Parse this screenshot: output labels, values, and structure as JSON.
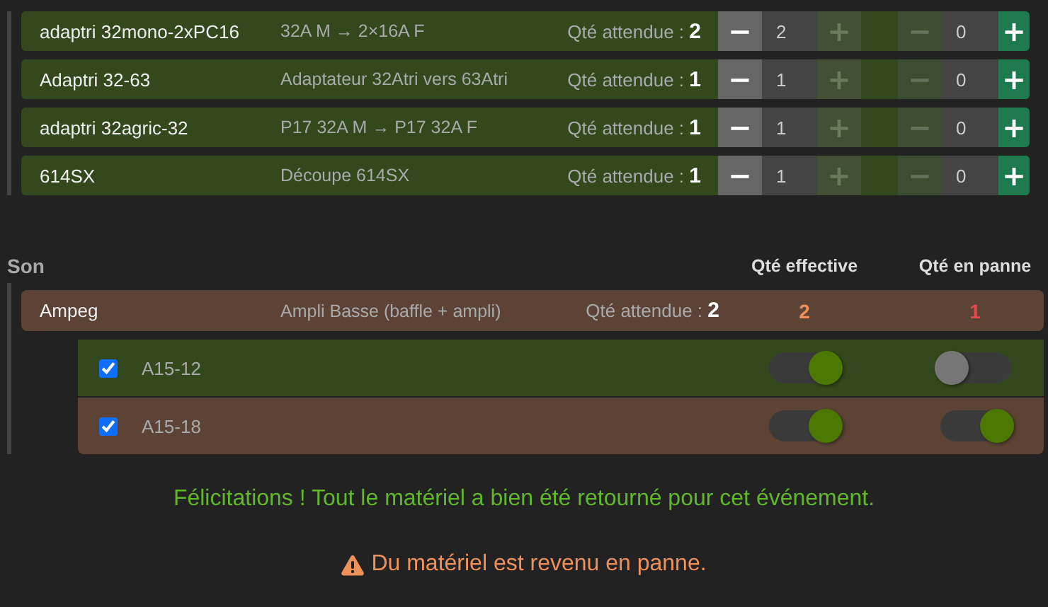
{
  "adapters": [
    {
      "name": "adaptri 32mono-2xPC16",
      "description": "32A M → 2×16A F",
      "expected": "Qté attendue : **2**",
      "ok": {
        "minus": {
          "symbol": "−",
          "disabled": false
        },
        "value": "2",
        "plus": {
          "symbol": "+",
          "disabled": true
        }
      },
      "broken": {
        "minus": {
          "symbol": "−",
          "disabled": true
        },
        "value": "0",
        "plus": {
          "symbol": "+",
          "disabled": false
        }
      }
    },
    {
      "name": "Adaptri 32-63",
      "description": "Adaptateur 32Atri vers 63Atri",
      "expected": "Qté attendue : **1**",
      "ok": {
        "minus": {
          "symbol": "−",
          "disabled": false
        },
        "value": "1",
        "plus": {
          "symbol": "+",
          "disabled": true
        }
      },
      "broken": {
        "minus": {
          "symbol": "−",
          "disabled": true
        },
        "value": "0",
        "plus": {
          "symbol": "+",
          "disabled": false
        }
      }
    },
    {
      "name": "adaptri 32agric-32",
      "description": "P17 32A M → P17 32A F",
      "expected": "Qté attendue : **1**",
      "ok": {
        "minus": {
          "symbol": "−",
          "disabled": false
        },
        "value": "1",
        "plus": {
          "symbol": "+",
          "disabled": true
        }
      },
      "broken": {
        "minus": {
          "symbol": "−",
          "disabled": true
        },
        "value": "0",
        "plus": {
          "symbol": "+",
          "disabled": false
        }
      }
    },
    {
      "name": "614SX",
      "description": "Découpe 614SX",
      "expected": "Qté attendue : **1**",
      "ok": {
        "minus": {
          "symbol": "−",
          "disabled": false
        },
        "value": "1",
        "plus": {
          "symbol": "+",
          "disabled": true
        }
      },
      "broken": {
        "minus": {
          "symbol": "−",
          "disabled": true
        },
        "value": "0",
        "plus": {
          "symbol": "+",
          "disabled": false
        }
      }
    }
  ],
  "son": {
    "title": "Son",
    "columns": [
      "Qté effective",
      "Qté en panne"
    ],
    "items": [
      {
        "name": "Ampeg",
        "description": "Ampli Basse (baffle + ampli)",
        "expected": "Qté attendue : **2**",
        "effective": "2",
        "broken": "1",
        "damaged": true,
        "units": [
          {
            "name": "A15-12",
            "checked": true,
            "returned": true,
            "broken": false
          },
          {
            "name": "A15-18",
            "checked": true,
            "returned": true,
            "broken": true
          }
        ]
      }
    ]
  },
  "messages": [
    {
      "kind": "success",
      "text": "Félicitations ! Tout le matériel a bien été retourné pour cet événement."
    },
    {
      "kind": "warning",
      "text": "Du matériel est revenu en panne."
    }
  ]
}
